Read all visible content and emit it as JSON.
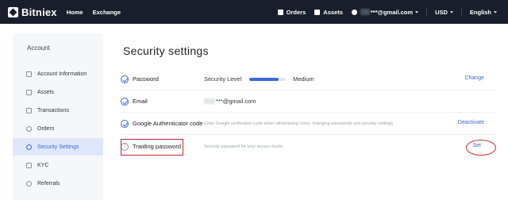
{
  "topbar": {
    "brand": "Bitniex",
    "nav": [
      "Home",
      "Exchange"
    ],
    "orders_label": "Orders",
    "assets_label": "Assets",
    "email": "***@gmail.com",
    "currency": "USD",
    "language": "English"
  },
  "sidebar": {
    "heading": "Account",
    "items": [
      {
        "label": "Account Information",
        "icon": "id-card-icon"
      },
      {
        "label": "Assets",
        "icon": "wallet-icon"
      },
      {
        "label": "Transactions",
        "icon": "receipt-icon"
      },
      {
        "label": "Orders",
        "icon": "orders-icon"
      },
      {
        "label": "Security Settings",
        "icon": "shield-icon",
        "active": true
      },
      {
        "label": "KYC",
        "icon": "kyc-icon"
      },
      {
        "label": "Referrals",
        "icon": "person-icon"
      }
    ]
  },
  "main": {
    "title": "Security settings",
    "rows": [
      {
        "label": "Password",
        "level_label": "Security Level",
        "level_fraction": 0.8,
        "level_value": "Medium",
        "action": "Change",
        "status": "verified"
      },
      {
        "label": "Email",
        "value": "***@gmail.com",
        "status": "verified"
      },
      {
        "label": "Google Authenticator code",
        "hint": "Enter Google verification code when withdrawing coins, changing passwords and security settings",
        "action": "Deactivate",
        "status": "verified"
      },
      {
        "label": "Traiding password",
        "hint": "Security password for your access funds",
        "action": "Set",
        "status": "warning"
      }
    ]
  },
  "colors": {
    "topbar_bg": "#181e2b",
    "accent": "#3a6ad9",
    "highlight": "#c0272d",
    "sidebar_bg": "#f5f7fa",
    "active_bg": "#dfe7fb"
  }
}
